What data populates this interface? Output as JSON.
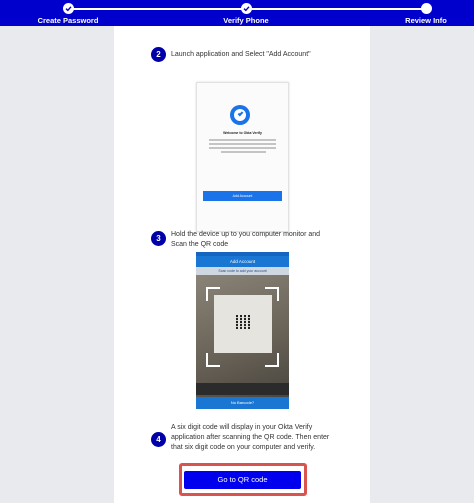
{
  "progress": {
    "steps": [
      {
        "label": "Create Password",
        "state": "done"
      },
      {
        "label": "Verify Phone",
        "state": "done"
      },
      {
        "label": "Review Info",
        "state": "pending"
      }
    ]
  },
  "instructions": [
    {
      "number": "2",
      "text": "Launch application and Select \"Add Account\""
    },
    {
      "number": "3",
      "text_line1": "Hold the device up to you computer monitor and",
      "text_line2": "Scan the QR code"
    },
    {
      "number": "4",
      "text_line1": "A six digit code will display in your Okta Verify",
      "text_line2": "application after scanning the QR code. Then enter",
      "text_line3": "that six digit code on your computer and verify."
    }
  ],
  "screenshot_welcome": {
    "title": "Welcome to Okta Verify",
    "button_label": "Add Account"
  },
  "screenshot_scan": {
    "header": "Add Account",
    "hint": "Scan code to add your account",
    "footer": "No Barcode?"
  },
  "cta": {
    "label": "Go to QR code"
  },
  "colors": {
    "brand_blue": "#0000cc",
    "highlight_red": "#d9534f"
  }
}
